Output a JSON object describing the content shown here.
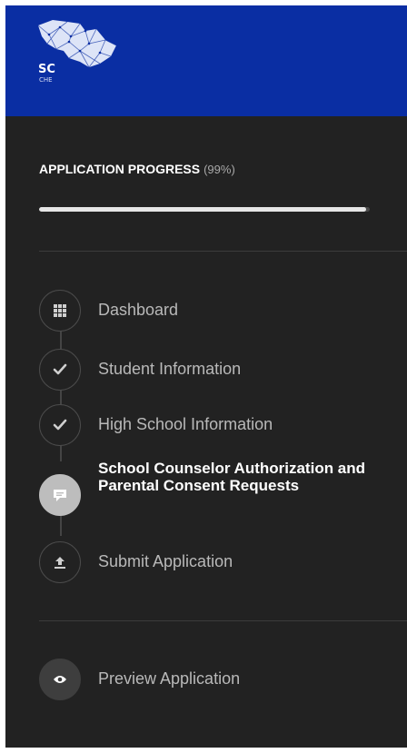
{
  "brand": {
    "logo_text": "SC",
    "logo_subtext": "CHE"
  },
  "progress": {
    "label": "APPLICATION PROGRESS",
    "percent_text": "(99%)",
    "percent_value": 99
  },
  "steps": [
    {
      "label": "Dashboard",
      "icon": "grid-icon",
      "state": "default"
    },
    {
      "label": "Student Information",
      "icon": "check-icon",
      "state": "complete"
    },
    {
      "label": "High School Information",
      "icon": "check-icon",
      "state": "complete"
    },
    {
      "label": "School Counselor Authorization and Parental Consent Requests",
      "icon": "comment-icon",
      "state": "active"
    },
    {
      "label": "Submit Application",
      "icon": "upload-icon",
      "state": "default"
    }
  ],
  "preview": {
    "label": "Preview Application",
    "icon": "eye-icon"
  },
  "colors": {
    "brand_bar": "#0a2ea3",
    "sidebar_bg": "#222222",
    "active_icon_bg": "#bdbdbd",
    "progress_fill": "#e6e6e6"
  }
}
